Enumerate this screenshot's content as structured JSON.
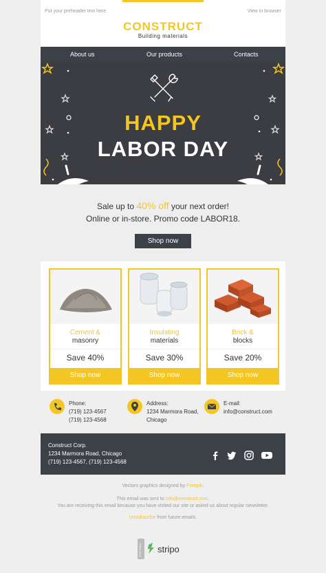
{
  "header": {
    "preheader": "Put your preheader text here",
    "view_in_browser": "View in browser",
    "brand_name": "CONSTRUCT",
    "brand_sub": "Building materials"
  },
  "nav": {
    "items": [
      {
        "label": "About us"
      },
      {
        "label": "Our products"
      },
      {
        "label": "Contacts"
      }
    ]
  },
  "hero": {
    "line1": "HAPPY",
    "line2": "LABOR DAY"
  },
  "sale": {
    "prefix": "Sale up to",
    "percent": "40% off",
    "suffix": "your next order!",
    "line2": "Online or in-store. Promo code LABOR18.",
    "button": "Shop now"
  },
  "products": [
    {
      "name_accent": "Cement &",
      "name_dark": "masonry",
      "save": "Save 40%",
      "button": "Shop now"
    },
    {
      "name_accent": "Insulating",
      "name_dark": "materials",
      "save": "Save 30%",
      "button": "Shop now"
    },
    {
      "name_accent": "Brick &",
      "name_dark": "blocks",
      "save": "Save 20%",
      "button": "Shop now"
    }
  ],
  "contacts": {
    "phone_label": "Phone:",
    "phone_1": "(719) 123-4567",
    "phone_2": "(719) 123-4568",
    "address_label": "Address:",
    "address_1": "1234 Marmora Road,",
    "address_2": "Chicago",
    "email_label": "E-mail:",
    "email": "info@construct.com"
  },
  "footer": {
    "company": "Construct Corp.",
    "address": "1234 Marmora Road, Chicago",
    "phones": "(719) 123-4567, (719) 123-4568",
    "social": [
      "facebook-icon",
      "twitter-icon",
      "instagram-icon",
      "youtube-icon"
    ]
  },
  "bottom": {
    "vectors_prefix": "Vectors graphics designed by",
    "vectors_link": "Freepik",
    "vectors_suffix": ".",
    "sent_prefix": "This email was sent to",
    "sent_email": "info@construct.com",
    "sent_suffix": ".",
    "receiving": "You are receiving this email because you have visited our site or asked us about regular newsletter.",
    "unsubscribe": "Unsubscribe",
    "unsubscribe_suffix": "from future emails.",
    "badge_text": "stripo",
    "badge_vertical": "FREE EMAIL"
  },
  "colors": {
    "accent": "#f3c623",
    "dark": "#3c4047",
    "hero_bg": "#3c3d42"
  }
}
